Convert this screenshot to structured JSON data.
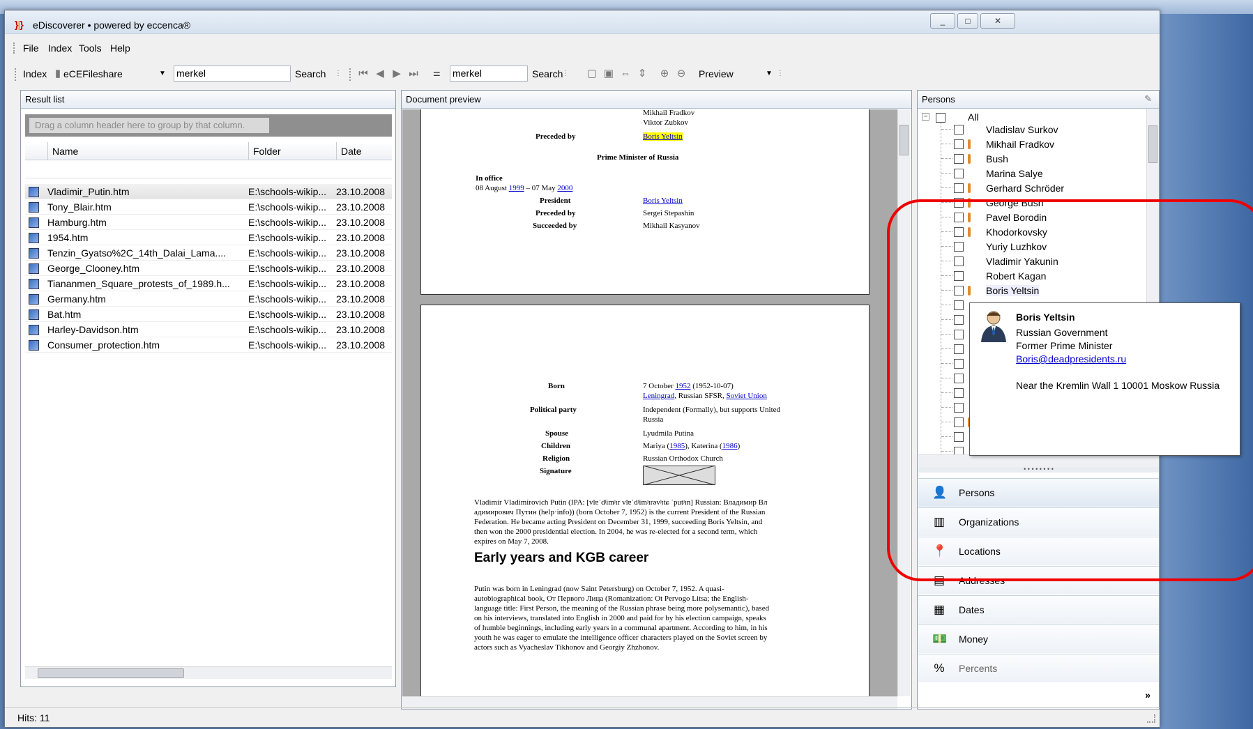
{
  "window": {
    "title": "eDiscoverer • powered by eccenca®",
    "controls": [
      "_",
      "□",
      "✕"
    ]
  },
  "menu": [
    "File",
    "Index",
    "Tools",
    "Help"
  ],
  "toolbar": {
    "index_label": "Index",
    "index_value": "eCEFileshare",
    "search_value_left": "merkel",
    "search_label_left": "Search",
    "equals": "=",
    "search_value_right": "merkel",
    "search_label_right": "Search",
    "preview_value": "Preview"
  },
  "result_list": {
    "title": "Result list",
    "group_hint": "Drag a column header here to group by that column.",
    "columns": [
      "Name",
      "Folder",
      "Date"
    ],
    "rows": [
      {
        "name": "Vladimir_Putin.htm",
        "folder": "E:\\schools-wikip...",
        "date": "23.10.2008"
      },
      {
        "name": "Tony_Blair.htm",
        "folder": "E:\\schools-wikip...",
        "date": "23.10.2008"
      },
      {
        "name": "Hamburg.htm",
        "folder": "E:\\schools-wikip...",
        "date": "23.10.2008"
      },
      {
        "name": "1954.htm",
        "folder": "E:\\schools-wikip...",
        "date": "23.10.2008"
      },
      {
        "name": "Tenzin_Gyatso%2C_14th_Dalai_Lama....",
        "folder": "E:\\schools-wikip...",
        "date": "23.10.2008"
      },
      {
        "name": "George_Clooney.htm",
        "folder": "E:\\schools-wikip...",
        "date": "23.10.2008"
      },
      {
        "name": "Tiananmen_Square_protests_of_1989.h...",
        "folder": "E:\\schools-wikip...",
        "date": "23.10.2008"
      },
      {
        "name": "Germany.htm",
        "folder": "E:\\schools-wikip...",
        "date": "23.10.2008"
      },
      {
        "name": "Bat.htm",
        "folder": "E:\\schools-wikip...",
        "date": "23.10.2008"
      },
      {
        "name": "Harley-Davidson.htm",
        "folder": "E:\\schools-wikip...",
        "date": "23.10.2008"
      },
      {
        "name": "Consumer_protection.htm",
        "folder": "E:\\schools-wikip...",
        "date": "23.10.2008"
      }
    ],
    "status": "Hits: 11"
  },
  "preview": {
    "title": "Document preview",
    "page1": {
      "top_names": [
        "Mikhail Fradkov",
        "Viktor Zubkov"
      ],
      "preceded_by_label": "Preceded by",
      "preceded_by_value": "Boris Yeltsin",
      "office_title": "Prime Minister of Russia",
      "in_office_label": "In office",
      "in_office_dates_a": "08 August",
      "in_office_year_a": "1999",
      "in_office_dates_b": "– 07 May",
      "in_office_year_b": "2000",
      "president_label": "President",
      "president_value": "Boris Yeltsin",
      "preceded_label2": "Preceded by",
      "preceded_value2": "Sergei Stepashin",
      "succeeded_label": "Succeeded by",
      "succeeded_value": "Mikhail Kasyanov"
    },
    "page2": {
      "born_label": "Born",
      "born_value_a": "7 October",
      "born_year": "1952",
      "born_value_b": "(1952-10-07)",
      "born_place_a": "Leningrad",
      "born_place_b": ", Russian SFSR,",
      "born_place_c": "Soviet Union",
      "party_label": "Political party",
      "party_value_1": "Independent (Formally), but supports United",
      "party_value_2": "Russia",
      "spouse_label": "Spouse",
      "spouse_value": "Lyudmila Putina",
      "children_label": "Children",
      "children_value_a": "Mariya (",
      "children_year_a": "1985",
      "children_value_b": "), Katerina (",
      "children_year_b": "1986",
      "children_value_c": ")",
      "religion_label": "Religion",
      "religion_value": "Russian Orthodox Church",
      "signature_label": "Signature",
      "intro_lines": [
        "Vladimir Vladimirovich Putin (IPA: [vlɐˈdʲimʲɪr vlɐˈdʲimʲɪrəvʲɪtɕ ˈputʲɪn] Russian: Владимир Вл",
        "адимирович Путин (help·info)) (born October 7, 1952) is the current President of the Russian",
        "Federation. He became acting President on December 31, 1999, succeeding Boris Yeltsin, and",
        "then won the 2000 presidential election. In 2004, he was re-elected for a second term, which",
        "expires on May 7, 2008."
      ],
      "heading": "Early years and KGB career",
      "body_lines": [
        "Putin was born in Leningrad (now Saint Petersburg) on October 7, 1952. A quasi-",
        "autobiographical book, От Первого Лица (Romanization: Ot Pervogo Litsa; the English-",
        "language title: First Person, the meaning of the Russian phrase being more polysemantic), based",
        "on his interviews, translated into English in 2000 and paid for by his election campaign, speaks",
        "of humble beginnings, including early years in a communal apartment. According to him, in his",
        "youth he was eager to emulate the intelligence officer characters played on the Soviet screen by",
        "actors such as Vyacheslav Tikhonov and Georgiy Zhzhonov."
      ]
    }
  },
  "persons": {
    "title": "Persons",
    "root": "All",
    "items": [
      {
        "label": "Vladislav Surkov",
        "tick": false
      },
      {
        "label": "Mikhail Fradkov",
        "tick": true
      },
      {
        "label": "Bush",
        "tick": true
      },
      {
        "label": "Marina Salye",
        "tick": false
      },
      {
        "label": "Gerhard Schröder",
        "tick": true
      },
      {
        "label": "George Bush",
        "tick": true
      },
      {
        "label": "Pavel Borodin",
        "tick": true
      },
      {
        "label": "Khodorkovsky",
        "tick": true
      },
      {
        "label": "Yuriy Luzhkov",
        "tick": false
      },
      {
        "label": "Vladimir Yakunin",
        "tick": false
      },
      {
        "label": "Robert Kagan",
        "tick": false
      },
      {
        "label": "Boris Yeltsin",
        "tick": true
      }
    ],
    "extra_checkbox_ticks": [
      false,
      false,
      false,
      false,
      false,
      false,
      false,
      false,
      true,
      false,
      false
    ]
  },
  "categories": [
    {
      "label": "Persons",
      "icon": "person-icon"
    },
    {
      "label": "Organizations",
      "icon": "building-icon"
    },
    {
      "label": "Locations",
      "icon": "pin-icon"
    },
    {
      "label": "Addresses",
      "icon": "address-card-icon"
    },
    {
      "label": "Dates",
      "icon": "calendar-icon"
    },
    {
      "label": "Money",
      "icon": "money-icon"
    },
    {
      "label": "Percents",
      "icon": "percent-icon"
    }
  ],
  "popup": {
    "name": "Boris Yeltsin",
    "org": "Russian Government",
    "role": "Former Prime Minister",
    "email": "Boris@deadpresidents.ru",
    "address": "Near the Kremlin Wall 1 10001 Moskow Russia"
  },
  "colors": {
    "highlight_ring": "#e00000",
    "tick": "#e28b2c",
    "link": "#0000cc"
  }
}
